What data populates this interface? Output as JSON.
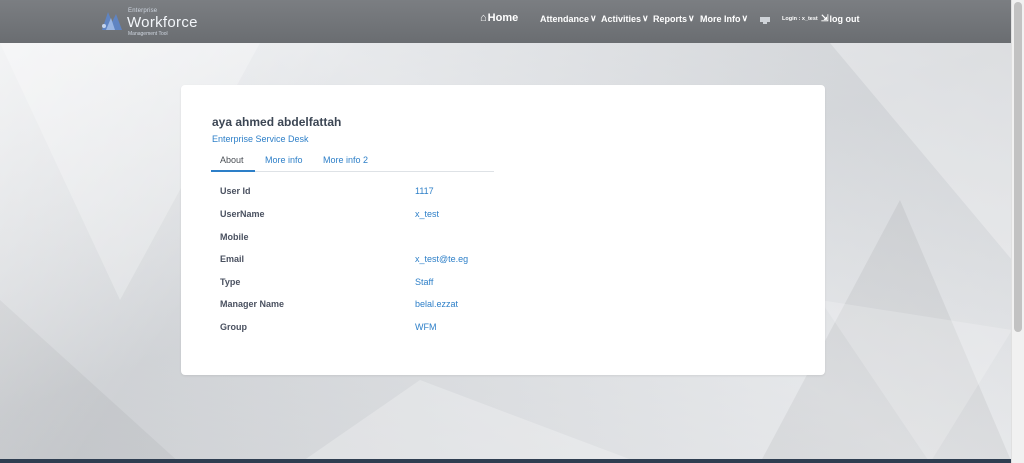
{
  "navbar": {
    "logo": {
      "top_text": "Enterprise",
      "title": "Workforce",
      "subtitle": "Management Tool"
    },
    "items": [
      {
        "label": "Home",
        "icon": "home-icon"
      },
      {
        "label": "Attendance",
        "icon": "chevron-down-icon"
      },
      {
        "label": "Activities",
        "icon": "chevron-down-icon"
      },
      {
        "label": "Reports",
        "icon": "chevron-down-icon"
      },
      {
        "label": "More Info",
        "icon": "chevron-down-icon"
      }
    ],
    "login_text": "Login : x_test",
    "logout_label": "log out",
    "chevron": "∨",
    "home_glyph": "⌂",
    "logout_glyph": "⇲"
  },
  "profile": {
    "name": "aya ahmed abdelfattah",
    "department": "Enterprise Service Desk",
    "tabs": [
      {
        "label": "About",
        "active": true
      },
      {
        "label": "More info",
        "active": false
      },
      {
        "label": "More info 2",
        "active": false
      }
    ],
    "fields": [
      {
        "label": "User Id",
        "value": "1117"
      },
      {
        "label": "UserName",
        "value": "x_test"
      },
      {
        "label": "Mobile",
        "value": ""
      },
      {
        "label": "Email",
        "value": "x_test@te.eg"
      },
      {
        "label": "Type",
        "value": "Staff"
      },
      {
        "label": "Manager Name",
        "value": "belal.ezzat"
      },
      {
        "label": "Group",
        "value": "WFM"
      }
    ]
  },
  "colors": {
    "accent": "#2d7fc8",
    "navbar": "#74777b",
    "footer": "#2f3e51"
  }
}
